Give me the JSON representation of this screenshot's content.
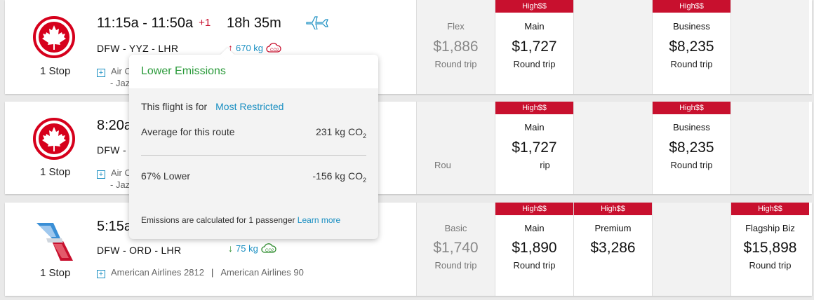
{
  "tooltip": {
    "title": "Lower Emissions",
    "flight_is_for_label": "This flight is for",
    "flight_is_for_value": "Most Restricted",
    "average_label": "Average for this route",
    "average_value": "231 kg CO",
    "average_sub": "2",
    "lower_label": "67% Lower",
    "lower_value": "-156 kg CO",
    "lower_sub": "2",
    "footer_text": "Emissions are calculated for 1 passenger",
    "footer_link": "Learn more"
  },
  "flights": [
    {
      "airline_logo": "air-canada-maple-leaf",
      "time": "11:15a - 11:50a",
      "plus_days": "+1",
      "duration": "18h 35m",
      "route": "DFW - YYZ - LHR",
      "emissions": "670 kg",
      "emissions_dir": "up",
      "stops": "1 Stop",
      "operator_line1": "Air C",
      "operator_line2": "- Jaz",
      "fares": [
        {
          "badge": "",
          "cabin": "Flex",
          "price": "$1,886",
          "trip": "Round trip"
        },
        {
          "badge": "High$$",
          "cabin": "Main",
          "price": "$1,727",
          "trip": "Round trip"
        },
        {
          "badge": "",
          "cabin": "",
          "price": "",
          "trip": ""
        },
        {
          "badge": "High$$",
          "cabin": "Business",
          "price": "$8,235",
          "trip": "Round trip"
        },
        {
          "badge": "",
          "cabin": "",
          "price": "",
          "trip": ""
        }
      ]
    },
    {
      "airline_logo": "air-canada-maple-leaf",
      "time": "8:20a",
      "route": "DFW - Y",
      "stops": "1 Stop",
      "operator_line1": "Air C",
      "operator_line2": "- Jaz",
      "fares": [
        {
          "badge": "",
          "cabin": "",
          "price": "",
          "trip": "Rou"
        },
        {
          "badge": "High$$",
          "cabin": "Main",
          "price": "$1,727",
          "trip": "rip"
        },
        {
          "badge": "",
          "cabin": "",
          "price": "",
          "trip": ""
        },
        {
          "badge": "High$$",
          "cabin": "Business",
          "price": "$8,235",
          "trip": "Round trip"
        },
        {
          "badge": "",
          "cabin": "",
          "price": "",
          "trip": ""
        }
      ]
    },
    {
      "airline_logo": "american-airlines-flight-symbol",
      "time": "5:15a",
      "route": "DFW - ORD - LHR",
      "emissions": "75 kg",
      "emissions_dir": "down",
      "stops": "1 Stop",
      "operator_a": "American Airlines 2812",
      "operator_sep": "|",
      "operator_b": "American Airlines 90",
      "fares": [
        {
          "badge": "",
          "cabin": "Basic",
          "price": "$1,740",
          "trip": "Round trip"
        },
        {
          "badge": "High$$",
          "cabin": "Main",
          "price": "$1,890",
          "trip": "Round trip"
        },
        {
          "badge": "High$$",
          "cabin": "Premium",
          "price": "$3,286",
          "trip": ""
        },
        {
          "badge": "",
          "cabin": "",
          "price": "",
          "trip": ""
        },
        {
          "badge": "High$$",
          "cabin": "Flagship Biz",
          "price": "$15,898",
          "trip": "Round trip"
        }
      ]
    }
  ],
  "colors": {
    "accent_red": "#c8102e",
    "link_blue": "#1a8fc2",
    "green": "#2a9a3a"
  }
}
